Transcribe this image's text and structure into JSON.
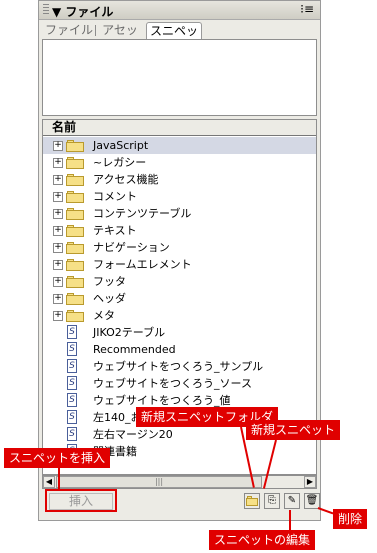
{
  "panel": {
    "title": "▼ ファイル",
    "tabs": [
      {
        "label": "ファイル",
        "active": false
      },
      {
        "label": "アセット",
        "active": false
      },
      {
        "label": "スニペット",
        "active": true
      }
    ],
    "column_header": "名前",
    "items": [
      {
        "type": "folder",
        "label": "JavaScript",
        "selected": true
      },
      {
        "type": "folder",
        "label": "~レガシー"
      },
      {
        "type": "folder",
        "label": "アクセス機能"
      },
      {
        "type": "folder",
        "label": "コメント"
      },
      {
        "type": "folder",
        "label": "コンテンツテーブル"
      },
      {
        "type": "folder",
        "label": "テキスト"
      },
      {
        "type": "folder",
        "label": "ナビゲーション"
      },
      {
        "type": "folder",
        "label": "フォームエレメント"
      },
      {
        "type": "folder",
        "label": "フッタ"
      },
      {
        "type": "folder",
        "label": "ヘッダ"
      },
      {
        "type": "folder",
        "label": "メタ"
      },
      {
        "type": "snippet",
        "label": "JIKO2テーブル"
      },
      {
        "type": "snippet",
        "label": "Recommended"
      },
      {
        "type": "snippet",
        "label": "ウェブサイトをつくろう_サンプル"
      },
      {
        "type": "snippet",
        "label": "ウェブサイトをつくろう_ソース"
      },
      {
        "type": "snippet",
        "label": "ウェブサイトをつくろう_値"
      },
      {
        "type": "snippet",
        "label": "左140_お薦め"
      },
      {
        "type": "snippet",
        "label": "左右マージン20"
      },
      {
        "type": "snippet",
        "label": "関連書籍"
      }
    ],
    "insert_button": "挿入"
  },
  "callouts": {
    "insert": "スニペットを挿入",
    "new_folder": "新規スニペットフォルダ",
    "new_snippet": "新規スニペット",
    "edit": "スニペットの編集",
    "delete": "削除"
  },
  "icons": {
    "panel_menu": "panel-options-icon",
    "collapse": "collapse-triangle-icon"
  },
  "colors": {
    "annotation": "#e00000",
    "selection": "#d4d8e4",
    "folder": "#f6e087"
  }
}
